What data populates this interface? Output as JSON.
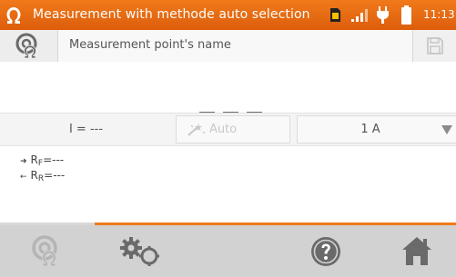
{
  "status_bar": {
    "title": "Measurement with methode auto selection",
    "clock": "11:13",
    "icons": [
      "app-logo-icon",
      "sim-card-icon",
      "signal-strength-icon",
      "power-plug-icon",
      "battery-icon"
    ]
  },
  "name_field": {
    "placeholder": "Measurement point's name",
    "icons": [
      "measurement-point-icon",
      "pencil-icon",
      "save-icon"
    ]
  },
  "result": {
    "main_value": "- - -"
  },
  "params": {
    "current": "I = ---",
    "auto_label": "Auto",
    "range_value": "1 A"
  },
  "subresults": {
    "forward_label": "R",
    "forward_sub": "F",
    "forward_value": "=---",
    "reverse_label": "R",
    "reverse_sub": "R",
    "reverse_value": "=---"
  },
  "toolbar": {
    "buttons": [
      "measurement-point-icon",
      "settings-gears-icon",
      "help-icon",
      "home-icon"
    ]
  },
  "colors": {
    "accent": "#f07a1a",
    "toolbar_bg": "#d2d2d2",
    "icon_gray": "#6a6a6a"
  }
}
